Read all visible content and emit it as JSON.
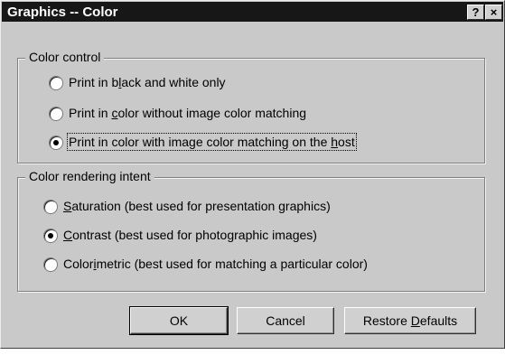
{
  "window": {
    "title": "Graphics -- Color",
    "help_button": "?",
    "close_button": "×"
  },
  "color_control": {
    "legend": "Color control",
    "options": [
      {
        "pre": "Print in b",
        "acc": "l",
        "post": "ack and white only",
        "selected": false
      },
      {
        "pre": "Print in ",
        "acc": "c",
        "post": "olor without image color matching",
        "selected": false
      },
      {
        "pre": "Print in color with image color matching on the ",
        "acc": "h",
        "post": "ost",
        "selected": true
      }
    ]
  },
  "rendering_intent": {
    "legend": "Color rendering intent",
    "options": [
      {
        "pre": "",
        "acc": "S",
        "post": "aturation (best used for presentation graphics)",
        "selected": false
      },
      {
        "pre": "",
        "acc": "C",
        "post": "ontrast (best used for photographic images)",
        "selected": true
      },
      {
        "pre": "Color",
        "acc": "i",
        "post": "metric (best used for matching a particular color)",
        "selected": false
      }
    ]
  },
  "buttons": {
    "ok": "OK",
    "cancel": "Cancel",
    "restore_pre": "Restore ",
    "restore_acc": "D",
    "restore_post": "efaults"
  }
}
